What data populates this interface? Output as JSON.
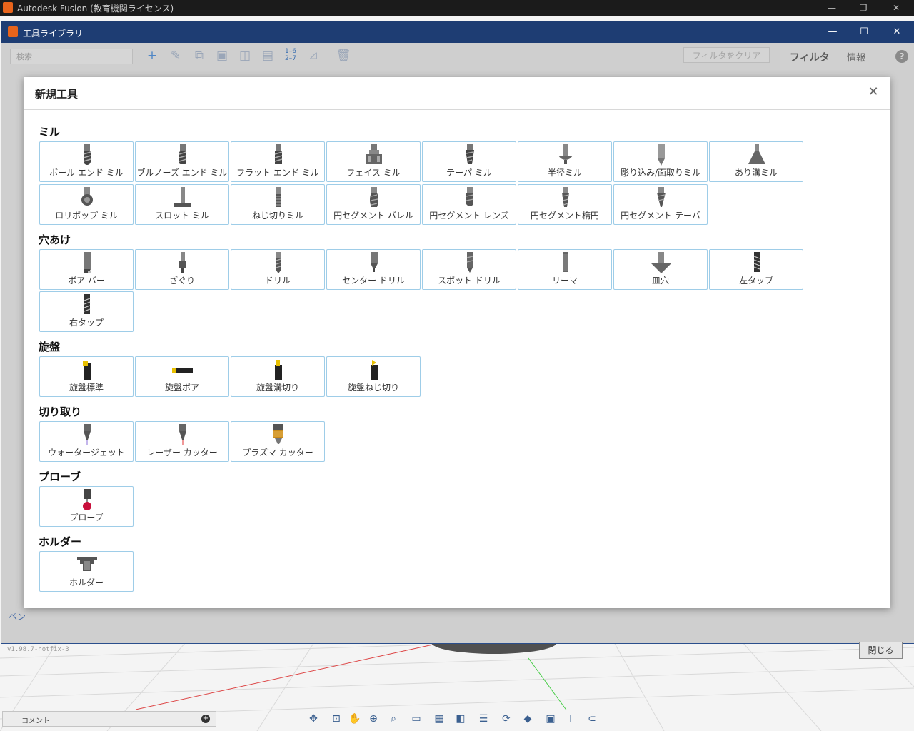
{
  "app": {
    "title": "Autodesk Fusion (教育機関ライセンス)",
    "window_controls": [
      "—",
      "❐",
      "✕"
    ]
  },
  "library_window": {
    "title": "工具ライブラリ",
    "window_controls": [
      "—",
      "☐",
      "✕"
    ],
    "search_placeholder": "検索",
    "filter_clear": "フィルタをクリア",
    "tab_filter": "フィルタ",
    "tab_info": "情報",
    "help": "?",
    "left_pane_text": "ペン",
    "version": "v1.98.7-hotfix-3",
    "close_button": "閉じる"
  },
  "modal": {
    "title": "新規工具",
    "close": "✕",
    "sections": [
      {
        "label": "ミル",
        "tools": [
          {
            "label": "ボール エンド ミル",
            "icon": "ball-end-mill-icon"
          },
          {
            "label": "ブルノーズ エンド ミル",
            "icon": "bull-nose-end-mill-icon"
          },
          {
            "label": "フラット エンド ミル",
            "icon": "flat-end-mill-icon"
          },
          {
            "label": "フェイス ミル",
            "icon": "face-mill-icon"
          },
          {
            "label": "テーパ ミル",
            "icon": "taper-mill-icon"
          },
          {
            "label": "半径ミル",
            "icon": "radius-mill-icon"
          },
          {
            "label": "彫り込み/面取りミル",
            "icon": "engrave-chamfer-mill-icon"
          },
          {
            "label": "あり溝ミル",
            "icon": "dovetail-mill-icon"
          },
          {
            "label": "ロリポップ ミル",
            "icon": "lollipop-mill-icon"
          },
          {
            "label": "スロット ミル",
            "icon": "slot-mill-icon"
          },
          {
            "label": "ねじ切りミル",
            "icon": "thread-mill-icon"
          },
          {
            "label": "円セグメント バレル",
            "icon": "circle-segment-barrel-icon"
          },
          {
            "label": "円セグメント レンズ",
            "icon": "circle-segment-lens-icon"
          },
          {
            "label": "円セグメント楕円",
            "icon": "circle-segment-oval-icon"
          },
          {
            "label": "円セグメント テーパ",
            "icon": "circle-segment-taper-icon"
          }
        ]
      },
      {
        "label": "穴あけ",
        "tools": [
          {
            "label": "ボア バー",
            "icon": "boring-bar-icon"
          },
          {
            "label": "ざぐり",
            "icon": "counterbore-icon"
          },
          {
            "label": "ドリル",
            "icon": "drill-icon"
          },
          {
            "label": "センター ドリル",
            "icon": "center-drill-icon"
          },
          {
            "label": "スポット ドリル",
            "icon": "spot-drill-icon"
          },
          {
            "label": "リーマ",
            "icon": "reamer-icon"
          },
          {
            "label": "皿穴",
            "icon": "countersink-icon"
          },
          {
            "label": "左タップ",
            "icon": "left-tap-icon"
          },
          {
            "label": "右タップ",
            "icon": "right-tap-icon"
          }
        ]
      },
      {
        "label": "旋盤",
        "tools": [
          {
            "label": "旋盤標準",
            "icon": "lathe-general-icon"
          },
          {
            "label": "旋盤ボア",
            "icon": "lathe-boring-icon"
          },
          {
            "label": "旋盤溝切り",
            "icon": "lathe-grooving-icon"
          },
          {
            "label": "旋盤ねじ切り",
            "icon": "lathe-threading-icon"
          }
        ]
      },
      {
        "label": "切り取り",
        "tools": [
          {
            "label": "ウォータージェット",
            "icon": "waterjet-icon"
          },
          {
            "label": "レーザー カッター",
            "icon": "laser-cutter-icon"
          },
          {
            "label": "プラズマ カッター",
            "icon": "plasma-cutter-icon"
          }
        ]
      },
      {
        "label": "プローブ",
        "tools": [
          {
            "label": "プローブ",
            "icon": "probe-icon"
          }
        ]
      },
      {
        "label": "ホルダー",
        "tools": [
          {
            "label": "ホルダー",
            "icon": "holder-icon"
          }
        ]
      }
    ]
  },
  "bottom": {
    "comment_label": "コメント",
    "comment_add": "+"
  },
  "colors": {
    "library_titlebar": "#1e3d73",
    "card_border": "#9ecde8",
    "app_titlebar": "#1b1b1b"
  }
}
